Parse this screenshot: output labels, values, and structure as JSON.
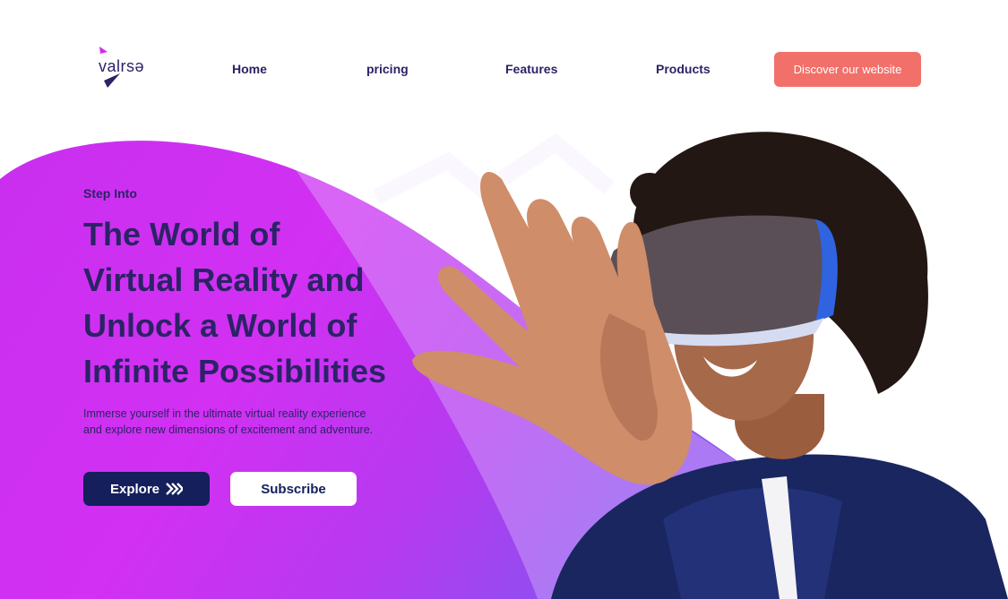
{
  "brand": {
    "name": "valrsə",
    "accent": "#d62bf0",
    "cta_color": "#f2706a",
    "dark": "#141f5c",
    "text": "#2b2366"
  },
  "nav": {
    "links": [
      "Home",
      "pricing",
      "Features",
      "Products"
    ],
    "cta_label": "Discover our website"
  },
  "hero": {
    "eyebrow": "Step Into",
    "headline": [
      "The World of",
      "Virtual Reality and",
      "Unlock a World of",
      "Infinite Possibilities"
    ],
    "description": "Immerse yourself in the ultimate virtual reality experience and explore new dimensions of excitement and adventure.",
    "explore_label": "Explore",
    "explore_icon": "double-chevron-right-icon",
    "subscribe_label": "Subscribe",
    "image": "woman-wearing-vr-headset"
  }
}
